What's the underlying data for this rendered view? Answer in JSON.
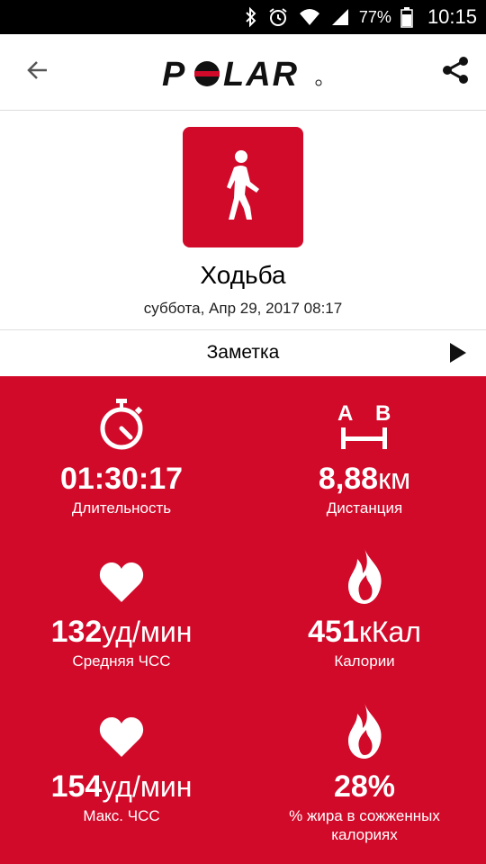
{
  "status_bar": {
    "battery_percent": "77%",
    "time": "10:15",
    "icons": [
      "bluetooth-icon",
      "alarm-icon",
      "wifi-icon",
      "signal-icon",
      "battery-icon"
    ]
  },
  "app_bar": {
    "logo_text": "POLAR",
    "back_icon": "arrow-back-icon",
    "share_icon": "share-icon"
  },
  "activity": {
    "sport_icon": "walking-person-icon",
    "title": "Ходьба",
    "date": "суббота, Апр 29, 2017 08:17",
    "tile_color": "#d10a2a"
  },
  "note": {
    "label": "Заметка",
    "arrow_icon": "play-arrow-icon"
  },
  "stats": [
    {
      "icon": "stopwatch-icon",
      "value": "01:30:17",
      "unit": "",
      "label": "Длительность"
    },
    {
      "icon": "distance-ab-icon",
      "value": "8,88",
      "unit": "км",
      "label": "Дистанция"
    },
    {
      "icon": "heart-icon",
      "value": "132",
      "unit": "уд/мин",
      "label": "Средняя ЧСС"
    },
    {
      "icon": "flame-icon",
      "value": "451",
      "unit": "кКал",
      "label": "Калории"
    },
    {
      "icon": "heart-icon",
      "value": "154",
      "unit": "уд/мин",
      "label": "Макс. ЧСС"
    },
    {
      "icon": "flame-icon",
      "value": "28%",
      "unit": "",
      "label": "% жира в сожженных калориях"
    }
  ],
  "colors": {
    "brand_red": "#d10a2a",
    "status_bar": "#000000",
    "text": "#000000",
    "icon_gray": "#555555"
  }
}
